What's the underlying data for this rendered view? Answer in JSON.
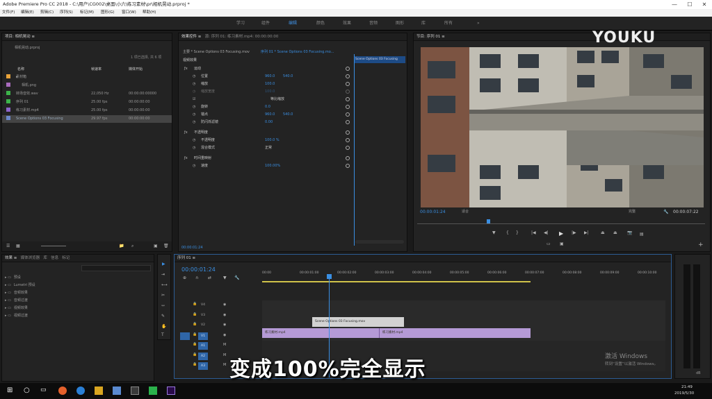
{
  "window": {
    "title": "Adobe Premiere Pro CC 2018 - C:\\用户\\CG002\\桌面\\小六\\练习素材\\pr\\相机晃动.prproj *",
    "controls": [
      "—",
      "☐",
      "✕"
    ]
  },
  "menu": [
    "文件(F)",
    "编辑(E)",
    "剪辑(C)",
    "序列(S)",
    "标记(M)",
    "图形(G)",
    "窗口(W)",
    "帮助(H)"
  ],
  "workspaces": {
    "items": [
      "学习",
      "组件",
      "编辑",
      "颜色",
      "效果",
      "音频",
      "图形",
      "库",
      "所有"
    ],
    "active": "编辑",
    "more": "»"
  },
  "project": {
    "title": "项目: 相机晃动",
    "file": "相机晃动.prproj",
    "selected": "1 项已选择, 共 6 项",
    "col_name": "名称",
    "col_fps": "帧速率",
    "col_start": "媒体开始",
    "items": [
      {
        "name": "素材箱",
        "fps": "",
        "start": "",
        "color": "#e8a33a",
        "indent": 0,
        "arrow": "▸"
      },
      {
        "name": "相机.png",
        "fps": "",
        "start": "",
        "color": "#a86bbd",
        "indent": 1,
        "arrow": ""
      },
      {
        "name": "转场音效.wav",
        "fps": "22,050 Hz",
        "start": "00:00:00:00000",
        "color": "#3cb34a",
        "indent": 0,
        "arrow": ""
      },
      {
        "name": "序列 01",
        "fps": "25.00 fps",
        "start": "00:00:00:00",
        "color": "#3cb34a",
        "indent": 0,
        "arrow": ""
      },
      {
        "name": "练习素材.mp4",
        "fps": "25.00 fps",
        "start": "00:00:00:00",
        "color": "#8c63c9",
        "indent": 0,
        "arrow": ""
      },
      {
        "name": "Scene Options 03 Focusing",
        "fps": "29.97 fps",
        "start": "00:00:00:00",
        "color": "#6b87c9",
        "indent": 0,
        "arrow": ""
      }
    ]
  },
  "effect_controls": {
    "tabs": [
      "效果控件",
      "源: 序列 01: 练习素材.mp4: 00:00:00:00"
    ],
    "master": "主要 * Scene Options 03 Focusing.mov",
    "seq": "序列 01 * Scene Options 03 Focusing.mo...",
    "section": "视频效果",
    "clip_label": "Scene Options 03 Focusing",
    "rows": [
      {
        "label": "运动",
        "v1": "",
        "v2": "",
        "depth": 0,
        "fx": true
      },
      {
        "label": "位置",
        "v1": "960.0",
        "v2": "540.0",
        "depth": 1
      },
      {
        "label": "缩放",
        "v1": "100.0",
        "v2": "",
        "depth": 1
      },
      {
        "label": "缩放宽度",
        "v1": "100.0",
        "v2": "",
        "depth": 1,
        "dim": true
      },
      {
        "label": "等比缩放",
        "v1": "",
        "v2": "",
        "depth": 2,
        "check": true
      },
      {
        "label": "旋转",
        "v1": "0.0",
        "v2": "",
        "depth": 1
      },
      {
        "label": "锚点",
        "v1": "960.0",
        "v2": "540.0",
        "depth": 1
      },
      {
        "label": "防闪烁滤镜",
        "v1": "0.00",
        "v2": "",
        "depth": 1
      },
      {
        "label": "不透明度",
        "v1": "",
        "v2": "",
        "depth": 0,
        "fx": true
      },
      {
        "label": "不透明度",
        "v1": "100.0 %",
        "v2": "",
        "depth": 1,
        "blue": true
      },
      {
        "label": "混合模式",
        "v1": "正常",
        "v2": "",
        "depth": 1
      },
      {
        "label": "时间重映射",
        "v1": "",
        "v2": "",
        "depth": 0,
        "fx": true
      },
      {
        "label": "速度",
        "v1": "100.00%",
        "v2": "",
        "depth": 1
      }
    ],
    "timecode": "00:00:01:24"
  },
  "program": {
    "title": "节目: 序列 01",
    "timecode": "00:00:01:24",
    "fit": "适合",
    "quality": "完整",
    "duration": "00:00:07:22",
    "watermark": "YOUKU"
  },
  "effects": {
    "tabs": [
      "效果",
      "媒体浏览器",
      "库",
      "信息",
      "标记"
    ],
    "items": [
      "预设",
      "Lumetri 预设",
      "音频效果",
      "音频过渡",
      "视频效果",
      "视频过渡"
    ]
  },
  "timeline": {
    "title": "序列 01",
    "timecode": "00:00:01:24",
    "ruler": [
      "00:00",
      "00:00:01:00",
      "00:00:02:00",
      "00:00:03:00",
      "00:00:04:00",
      "00:00:05:00",
      "00:00:06:00",
      "00:00:07:00",
      "00:00:08:00",
      "00:00:09:00",
      "00:00:10:00"
    ],
    "tracks": [
      "V4",
      "V3",
      "V2",
      "V1",
      "A1",
      "A2",
      "A3"
    ],
    "clips": {
      "v2": "Scene Options 03 Focusing.mov",
      "v1a": "练习素材.mp4",
      "v1b": "练习素材.mp4"
    }
  },
  "subtitle": "变成100%完全显示",
  "activation": {
    "line1": "激活 Windows",
    "line2": "转到“设置”以激活 Windows。"
  },
  "taskbar": {
    "time": "21:49",
    "date": "2019/5/30"
  },
  "meter": {
    "db": "dB"
  }
}
